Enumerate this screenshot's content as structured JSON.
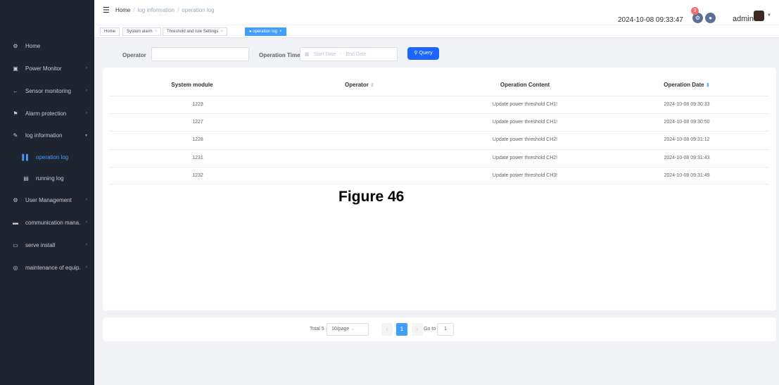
{
  "sidebar": {
    "items": [
      {
        "label": "Home",
        "icon": "dashboard-icon",
        "glyph": "⚙"
      },
      {
        "label": "Power Monitor",
        "icon": "monitor-icon",
        "glyph": "▣"
      },
      {
        "label": "Sensor monitoring",
        "icon": "sensor-icon",
        "glyph": "←"
      },
      {
        "label": "Alarm protection",
        "icon": "alarm-icon",
        "glyph": "⚑"
      },
      {
        "label": "log information",
        "icon": "log-icon",
        "glyph": "✎"
      },
      {
        "label": "operation log",
        "icon": "chart-icon",
        "glyph": "│"
      },
      {
        "label": "running log",
        "icon": "file-icon",
        "glyph": "▤"
      },
      {
        "label": "User Management",
        "icon": "gear-icon",
        "glyph": "⚙"
      },
      {
        "label": "communication mana.",
        "icon": "chat-icon",
        "glyph": "▬"
      },
      {
        "label": "serve install",
        "icon": "server-icon",
        "glyph": "▭"
      },
      {
        "label": "maintenance of equip.",
        "icon": "maintenance-icon",
        "glyph": "◎"
      }
    ]
  },
  "header": {
    "breadcrumb": [
      "Home",
      "log information",
      "operation log"
    ],
    "datetime": "2024-10-08 09:33:47",
    "badge_count": "3",
    "username": "admin"
  },
  "tags": [
    {
      "label": "Home"
    },
    {
      "label": "System alarm"
    },
    {
      "label": "Threshold and rule Settings"
    },
    {
      "label": "operation log"
    }
  ],
  "filter": {
    "operator_label": "Operator",
    "operator_value": "",
    "time_label": "Operation Time",
    "start_placeholder": "Start Date",
    "range_sep": "-",
    "end_placeholder": "End Date",
    "query_label": "Query"
  },
  "table": {
    "headers": [
      "System module",
      "Operator",
      "Operation Content",
      "Operation Date"
    ],
    "rows": [
      {
        "module": "1223",
        "operator": "",
        "content": "Update power threshold CH1!",
        "date": "2024-10-08 09:30:33"
      },
      {
        "module": "1227",
        "operator": "",
        "content": "Update power threshold CH1!",
        "date": "2024-10-08 09:30:50"
      },
      {
        "module": "1228",
        "operator": "",
        "content": "Update power threshold CH2!",
        "date": "2024-10-08 09:31:12"
      },
      {
        "module": "1231",
        "operator": "",
        "content": "Update power threshold CH2!",
        "date": "2024-10-08 09:31:43"
      },
      {
        "module": "1232",
        "operator": "",
        "content": "Update power threshold CH3!",
        "date": "2024-10-08 09:31:49"
      }
    ]
  },
  "caption": "Figure 46",
  "pagination": {
    "total": "Total 5",
    "page_size": "10/page",
    "current_page": "1",
    "goto_label": "Go to",
    "goto_value": "1"
  },
  "colors": {
    "sidebar_bg": "#1f2431",
    "accent": "#409eff",
    "query_button": "#1c66ff",
    "badge": "#f56c6c"
  }
}
